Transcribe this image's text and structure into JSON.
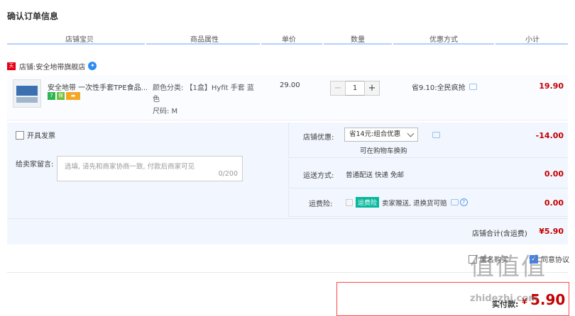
{
  "title": "确认订单信息",
  "columns": [
    "店铺宝贝",
    "商品属性",
    "单价",
    "数量",
    "优惠方式",
    "小计"
  ],
  "shop": {
    "label": "店铺:",
    "name": "安全地带旗舰店",
    "badge": "天猫"
  },
  "item": {
    "name": "安全地带 一次性手套TPE食品...",
    "props_line1": "颜色分类: 【1盒】Hyfit 手套 蓝",
    "props_line2": "色",
    "props_line3": "尺码: M",
    "price": "29.00",
    "quantity": "1",
    "minus": "−",
    "plus": "+",
    "promo": "省9.10:全民疯抢",
    "subtotal": "19.90"
  },
  "invoice_label": "开具发票",
  "message": {
    "label": "给卖家留言:",
    "placeholder": "选填, 请先和商家协商一致, 付款后商家可见",
    "counter": "0/200"
  },
  "shop_discount": {
    "label": "店铺优惠:",
    "selected": "省14元:组合优惠",
    "cart_note": "可在购物车换购",
    "value": "-14.00"
  },
  "shipping": {
    "label": "运送方式:",
    "text": "普通配送 快递 免邮",
    "value": "0.00"
  },
  "insurance": {
    "label": "运费险:",
    "tag": "运费险",
    "text": "卖家赠送, 退换货可赔",
    "value": "0.00"
  },
  "shop_total": {
    "label": "店铺合计(含运费)",
    "value": "¥5.90"
  },
  "bottom": {
    "anonymous": "匿名购买",
    "agree": "同意协议"
  },
  "pay": {
    "label": "实付款:",
    "currency": "¥",
    "value": "5.90"
  },
  "watermark": {
    "glyphs": "值",
    "site": "zhidezhi.com"
  },
  "colors": {
    "accent": "#c40000",
    "header_line": "#b2d1ff",
    "panel": "#f2f7ff",
    "pay_border": "#ff4949"
  }
}
